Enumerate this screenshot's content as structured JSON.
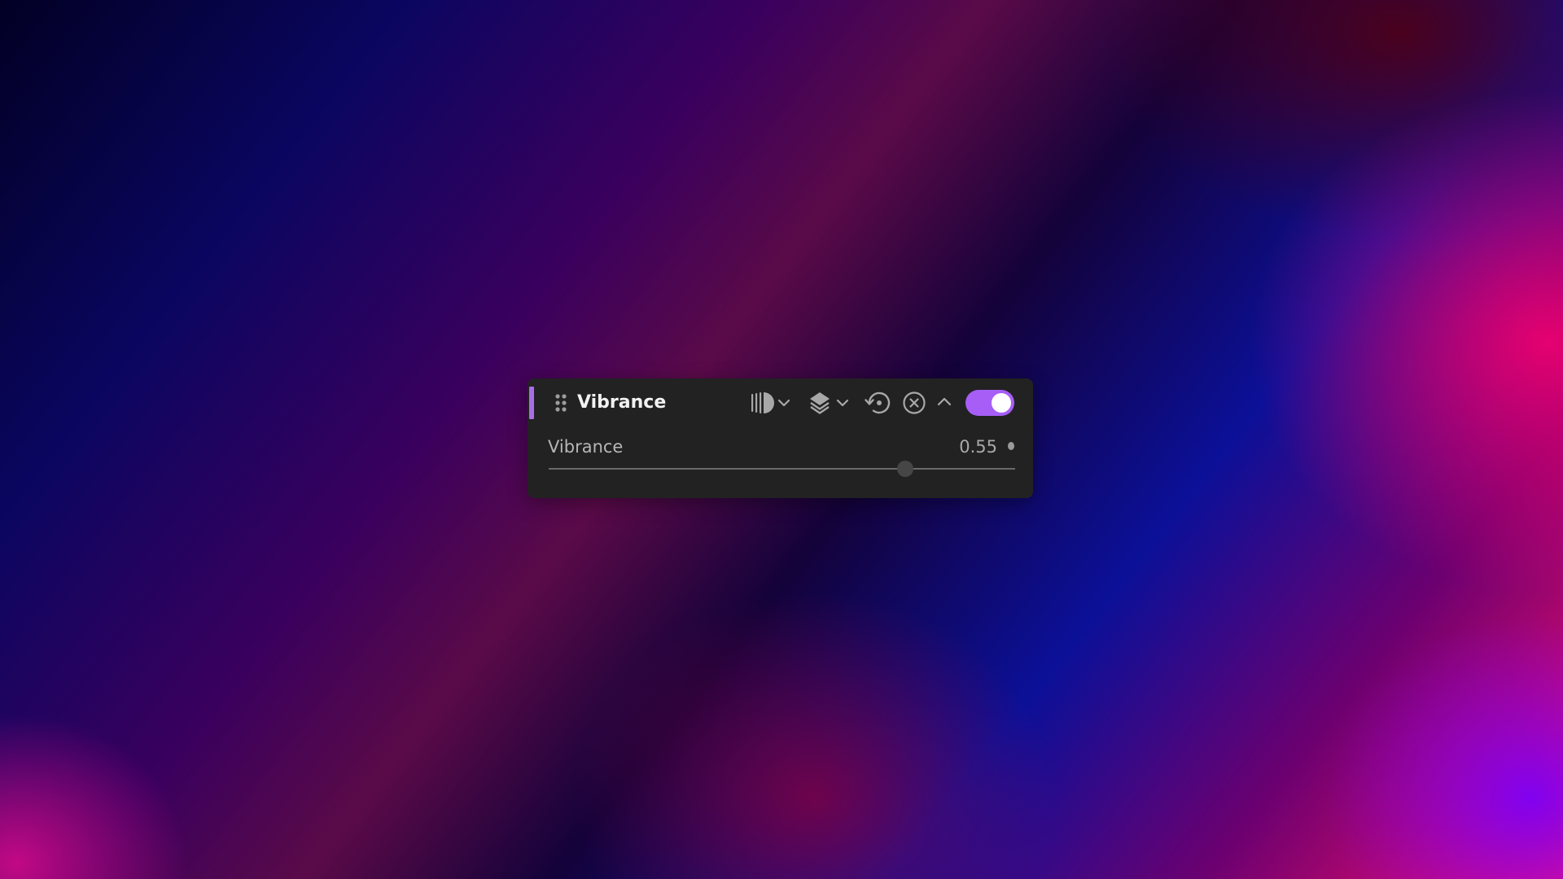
{
  "panel": {
    "title": "Vibrance",
    "accent_color": "#a86ee8",
    "enabled": true,
    "toggle_color": "#a65ef7",
    "icons": {
      "drag": "drag-handle-icon",
      "blend": "blend-mode-icon",
      "blend_dropdown": "chevron-down-icon",
      "layers": "layers-icon",
      "layers_dropdown": "chevron-down-icon",
      "reset": "reset-icon",
      "remove": "close-circle-icon",
      "collapse": "chevron-up-icon"
    }
  },
  "parameter": {
    "label": "Vibrance",
    "value": "0.55",
    "slider_level": 0.765
  }
}
